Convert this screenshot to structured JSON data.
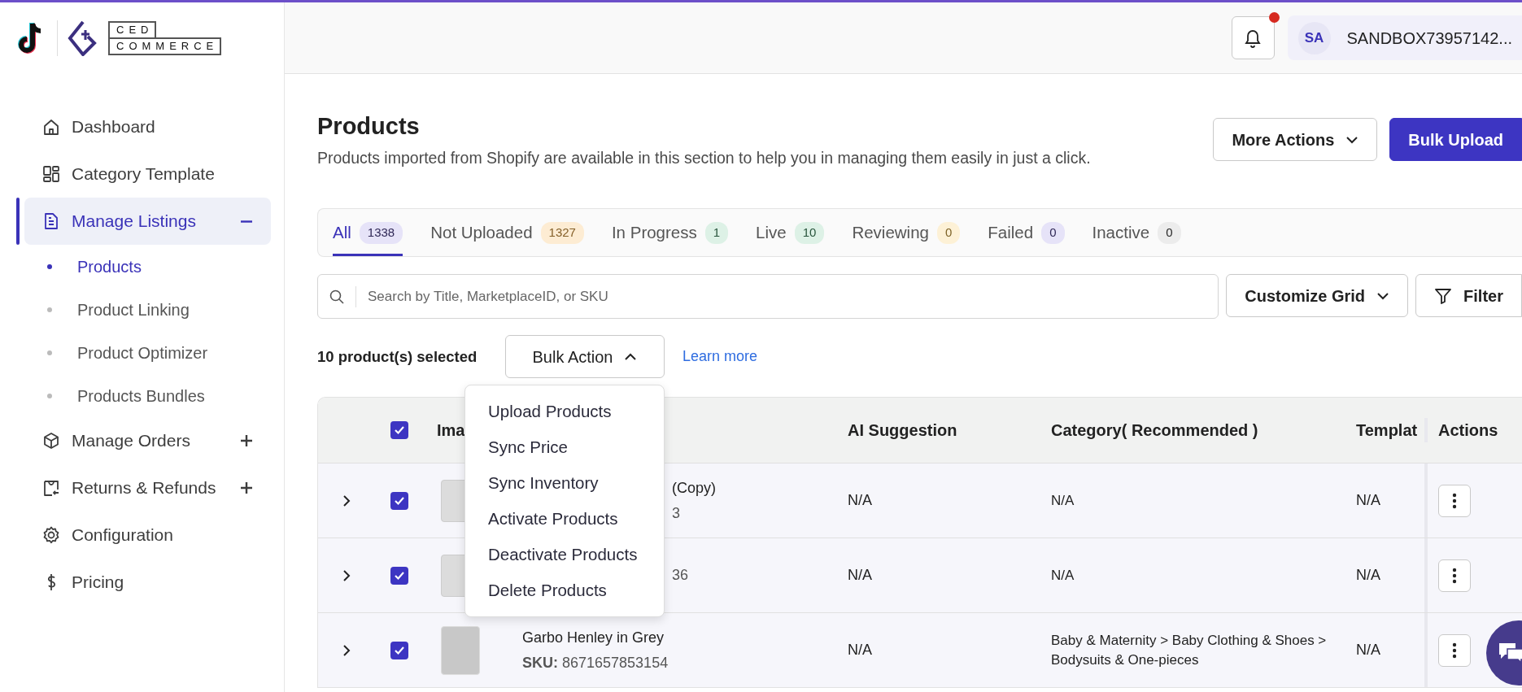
{
  "logo": {
    "line_1": "CED",
    "line_2": "COMMERCE"
  },
  "header": {
    "notification_dot": true,
    "user": {
      "initials": "SA",
      "name": "SANDBOX73957142..."
    }
  },
  "sidebar": {
    "items": [
      {
        "label": "Dashboard",
        "kind": "home",
        "selected": false
      },
      {
        "label": "Category Template",
        "kind": "grid",
        "selected": false
      },
      {
        "label": "Manage Listings",
        "kind": "document",
        "selected": true,
        "expanded": true,
        "children": [
          {
            "label": "Products",
            "selected": true
          },
          {
            "label": "Product Linking",
            "selected": false
          },
          {
            "label": "Product Optimizer",
            "selected": false
          },
          {
            "label": "Products Bundles",
            "selected": false
          }
        ]
      },
      {
        "label": "Manage Orders",
        "kind": "box",
        "selected": false,
        "expanded": false
      },
      {
        "label": "Returns & Refunds",
        "kind": "returns",
        "selected": false,
        "expanded": false
      },
      {
        "label": "Configuration",
        "kind": "gear",
        "selected": false
      },
      {
        "label": "Pricing",
        "kind": "dollar",
        "selected": false
      }
    ]
  },
  "page": {
    "title": "Products",
    "subtitle": "Products imported from Shopify are available in this section to help you in managing them easily in just a click.",
    "actions": [
      {
        "label": "More Actions",
        "kind": "dropdown"
      },
      {
        "label": "Bulk Upload",
        "kind": "primary"
      }
    ]
  },
  "tabs": [
    {
      "label": "All",
      "count": "1338",
      "color": "#e6e3f8",
      "selected": true
    },
    {
      "label": "Not Uploaded",
      "count": "1327",
      "color": "#fdecd3",
      "selected": false
    },
    {
      "label": "In Progress",
      "count": "1",
      "color": "#ddf1e6",
      "selected": false
    },
    {
      "label": "Live",
      "count": "10",
      "color": "#ddf1e6",
      "selected": false
    },
    {
      "label": "Reviewing",
      "count": "0",
      "color": "#fdf1d6",
      "selected": false
    },
    {
      "label": "Failed",
      "count": "0",
      "color": "#e6e3f8",
      "selected": false
    },
    {
      "label": "Inactive",
      "count": "0",
      "color": "#ececec",
      "selected": false
    }
  ],
  "search": {
    "placeholder": "Search by Title, MarketplaceID, or SKU"
  },
  "toolbar_buttons": [
    {
      "label": "Customize Grid",
      "kind": "dropdown"
    },
    {
      "label": "Filter",
      "kind": "filter"
    }
  ],
  "selection": {
    "text": "10 product(s) selected",
    "link": "Learn more",
    "bulk_action": {
      "label": "Bulk Action",
      "expanded": true,
      "items": [
        "Upload Products",
        "Sync Price",
        "Sync Inventory",
        "Activate Products",
        "Deactivate Products",
        "Delete Products"
      ]
    }
  },
  "table": {
    "header": {
      "checked": true,
      "image": "Ima",
      "ai_suggestion": "AI Suggestion",
      "category": "Category( Recommended )",
      "template": "Templat",
      "actions": "Actions"
    },
    "rows": [
      {
        "expanded": false,
        "checked": true,
        "kind": "no_image",
        "title": "(Copy)",
        "sku": "3",
        "ai_suggestion": "N/A",
        "category": "N/A",
        "template": "N/A"
      },
      {
        "expanded": false,
        "checked": true,
        "kind": "no_image",
        "sku": "36",
        "ai_suggestion": "N/A",
        "category": "N/A",
        "template": "N/A"
      },
      {
        "expanded": false,
        "checked": true,
        "kind": "photo",
        "title": "Garbo Henley in Grey",
        "sku_label": "SKU:",
        "sku": "8671657853154",
        "ai_suggestion": "N/A",
        "category": "Baby & Maternity > Baby Clothing & Shoes > Bodysuits & One-pieces",
        "template": "N/A"
      }
    ]
  }
}
